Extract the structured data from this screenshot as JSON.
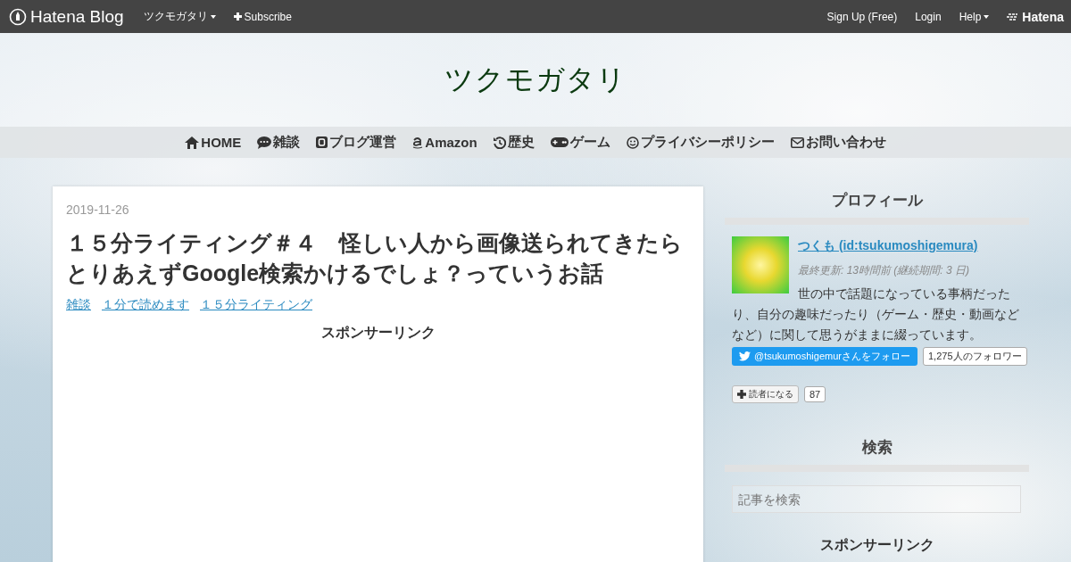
{
  "topbar": {
    "logo": "Hatena Blog",
    "blog_menu": "ツクモガタリ",
    "subscribe": "Subscribe",
    "sign_up": "Sign Up (Free)",
    "login": "Login",
    "help": "Help",
    "hatena": "Hatena"
  },
  "blog_title": "ツクモガタリ",
  "nav": [
    {
      "kind": "home",
      "label": "HOME"
    },
    {
      "kind": "chat",
      "label": "雑談"
    },
    {
      "kind": "blog",
      "label": "ブログ運営"
    },
    {
      "kind": "amazon",
      "label": "Amazon"
    },
    {
      "kind": "history",
      "label": "歴史"
    },
    {
      "kind": "game",
      "label": "ゲーム"
    },
    {
      "kind": "smile",
      "label": "プライバシーポリシー"
    },
    {
      "kind": "mail",
      "label": "お問い合わせ"
    }
  ],
  "article": {
    "date": "2019-11-26",
    "title": "１５分ライティング＃４　怪しい人から画像送られてきたらとりあえずGoogle検索かけるでしょ？っていうお話",
    "categories": [
      "雑談",
      "１分で読めます",
      "１５分ライティング"
    ],
    "sponsor": "スポンサーリンク"
  },
  "sidebar": {
    "profile_heading": "プロフィール",
    "user_link": "つくも (id:tsukumoshigemura)",
    "last_update": "最終更新: 13時間前 (継続期間: 3 日)",
    "description": "世の中で話題になっている事柄だったり、自分の趣味だったり（ゲーム・歴史・動画などなど）に関して思うがままに綴っています。",
    "follow_button": "@tsukumoshigemurさんをフォロー",
    "follower_count": "1,275人のフォロワー",
    "reader_button": "読者になる",
    "reader_count": "87",
    "search_heading": "検索",
    "search": {
      "placeholder": "記事を検索"
    },
    "sponsor_heading": "スポンサーリンク"
  }
}
